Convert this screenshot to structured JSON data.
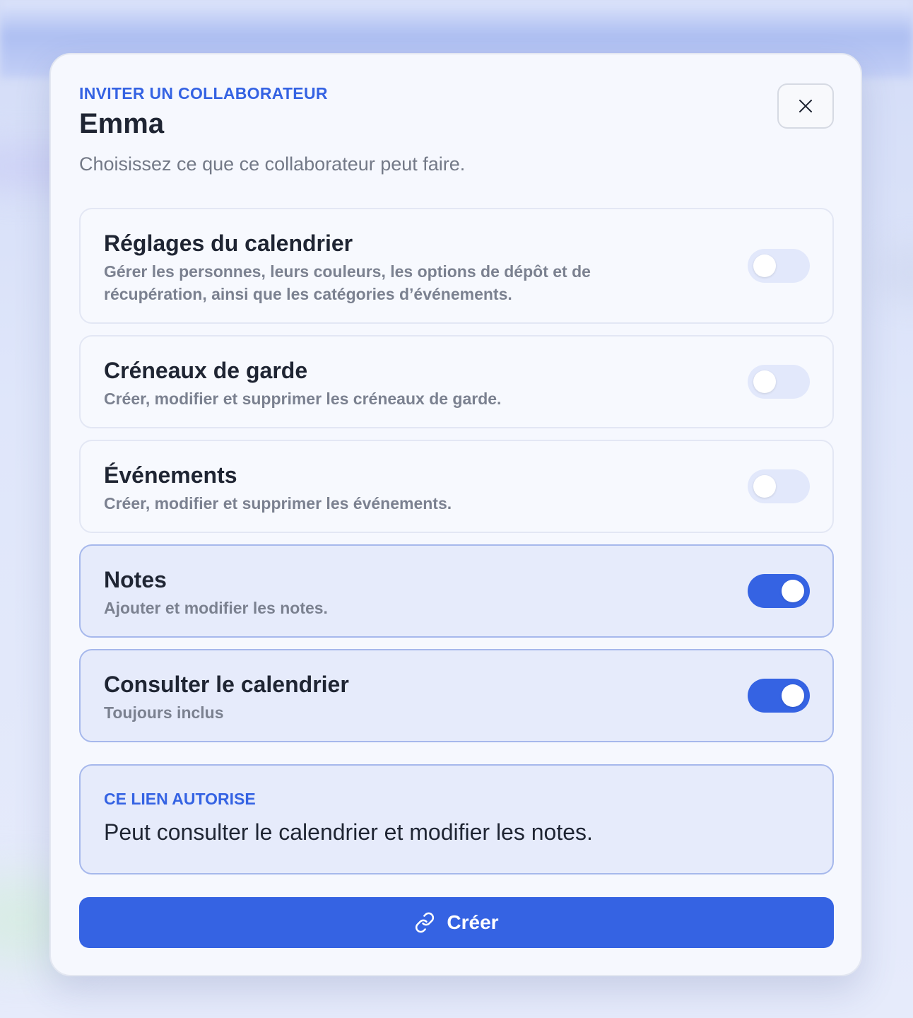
{
  "modal": {
    "eyebrow": "INVITER UN COLLABORATEUR",
    "title": "Emma",
    "subtitle": "Choisissez ce que ce collaborateur peut faire.",
    "close_icon": "close-icon"
  },
  "permissions": [
    {
      "title": "Réglages du calendrier",
      "description": "Gérer les personnes, leurs couleurs, les options de dépôt et de récupération, ainsi que les catégories d’événements.",
      "enabled": false
    },
    {
      "title": "Créneaux de garde",
      "description": "Créer, modifier et supprimer les créneaux de garde.",
      "enabled": false
    },
    {
      "title": "Événements",
      "description": "Créer, modifier et supprimer les événements.",
      "enabled": false
    },
    {
      "title": "Notes",
      "description": "Ajouter et modifier les notes.",
      "enabled": true
    },
    {
      "title": "Consulter le calendrier",
      "description": "Toujours inclus",
      "enabled": true
    }
  ],
  "summary": {
    "label": "CE LIEN AUTORISE",
    "text": "Peut consulter le calendrier et modifier les notes."
  },
  "create_button": {
    "label": "Créer",
    "icon": "link-icon"
  },
  "colors": {
    "accent": "#3563e3",
    "text": "#1f2533",
    "muted": "#7b8190",
    "toggle_off": "#e2e8fb",
    "card_on": "#e6ebfb"
  }
}
